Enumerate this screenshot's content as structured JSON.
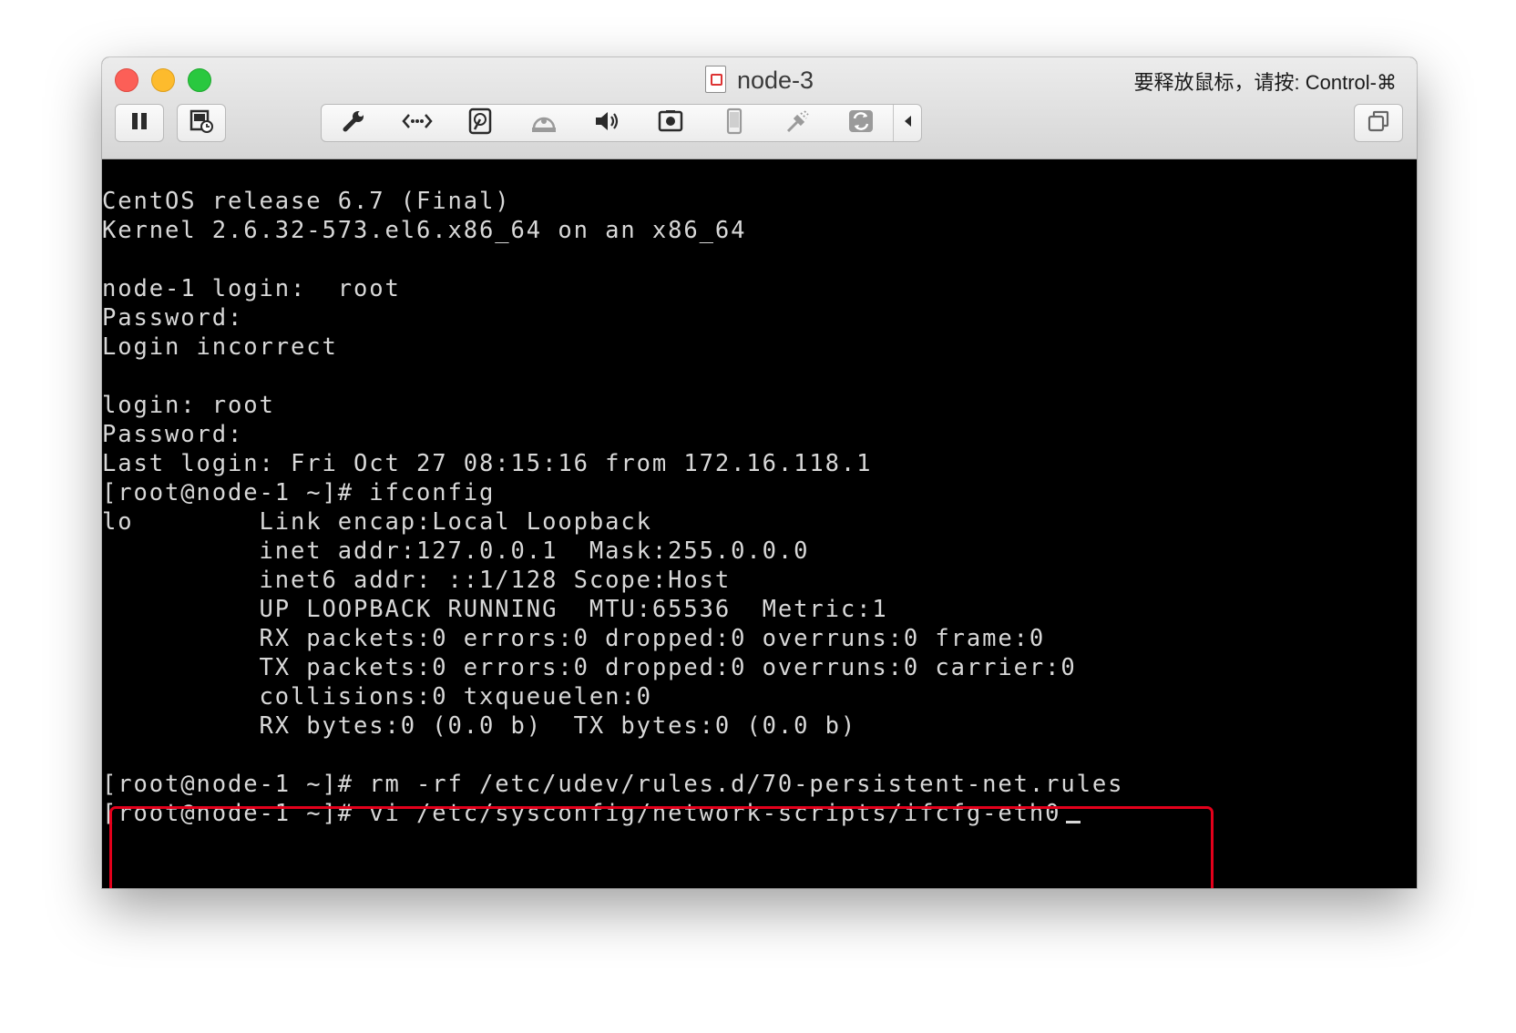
{
  "window": {
    "title": "node-3",
    "release_hint": "要释放鼠标，请按: Control-⌘"
  },
  "toolbar": {
    "left_buttons": [
      "pause-icon",
      "snapshot-icon"
    ],
    "group_icons": [
      "wrench-icon",
      "network-icon",
      "hard-disk-icon",
      "optical-drive-icon",
      "speaker-icon",
      "camera-icon",
      "phone-icon",
      "usb-icon",
      "sharing-icon",
      "collapse-arrow-icon"
    ],
    "right_button": "fullscreen-icon"
  },
  "terminal": {
    "lines": [
      "CentOS release 6.7 (Final)",
      "Kernel 2.6.32-573.el6.x86_64 on an x86_64",
      "",
      "node-1 login:  root",
      "Password:",
      "Login incorrect",
      "",
      "login: root",
      "Password:",
      "Last login: Fri Oct 27 08:15:16 from 172.16.118.1",
      "[root@node-1 ~]# ifconfig",
      "lo        Link encap:Local Loopback",
      "          inet addr:127.0.0.1  Mask:255.0.0.0",
      "          inet6 addr: ::1/128 Scope:Host",
      "          UP LOOPBACK RUNNING  MTU:65536  Metric:1",
      "          RX packets:0 errors:0 dropped:0 overruns:0 frame:0",
      "          TX packets:0 errors:0 dropped:0 overruns:0 carrier:0",
      "          collisions:0 txqueuelen:0",
      "          RX bytes:0 (0.0 b)  TX bytes:0 (0.0 b)",
      "",
      "[root@node-1 ~]# rm -rf /etc/udev/rules.d/70-persistent-net.rules",
      "[root@node-1 ~]# vi /etc/sysconfig/network-scripts/ifcfg-eth0"
    ]
  },
  "colors": {
    "highlight": "#e3001b",
    "terminal_text": "#d8d8d8",
    "terminal_bg": "#000000"
  }
}
